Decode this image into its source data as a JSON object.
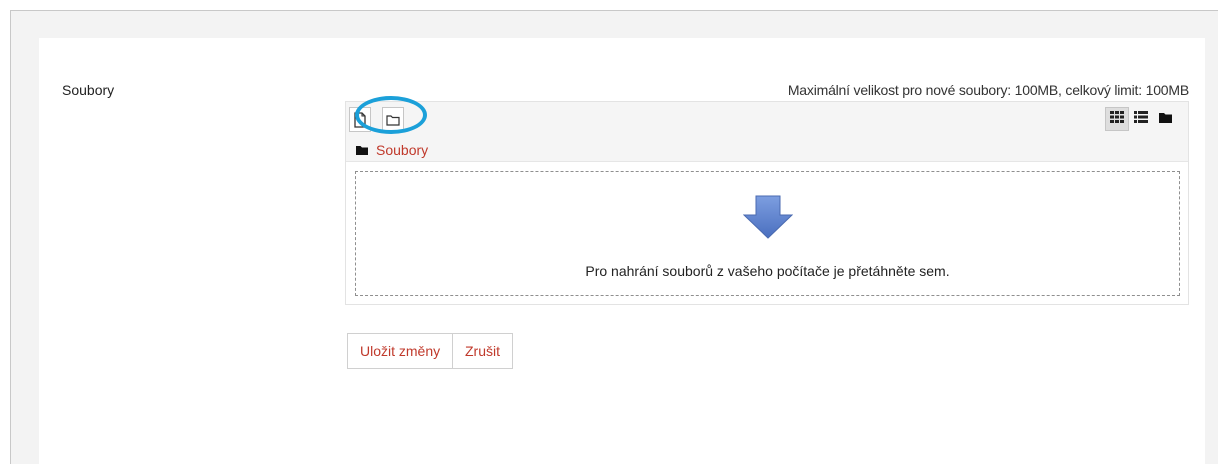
{
  "form": {
    "field_label": "Soubory",
    "max_size_text": "Maximální velikost pro nové soubory: 100MB, celkový limit: 100MB"
  },
  "filemanager": {
    "toolbar": {
      "add_file_icon": "file-icon",
      "create_folder_icon": "folder-icon",
      "views": [
        {
          "name": "grid-view-icon",
          "active": true
        },
        {
          "name": "list-view-icon",
          "active": false
        },
        {
          "name": "tree-view-icon",
          "active": false
        }
      ]
    },
    "breadcrumb": {
      "icon": "folder-icon",
      "label": "Soubory"
    },
    "dropzone": {
      "icon": "download-arrow-icon",
      "text": "Pro nahrání souborů z vašeho počítače je přetáhněte sem."
    }
  },
  "annotation": {
    "ring_color": "#1ba0d9"
  },
  "actions": {
    "save_label": "Uložit změny",
    "cancel_label": "Zrušit"
  },
  "colors": {
    "link": "#c0392b",
    "arrow": "#5b7fc7"
  }
}
